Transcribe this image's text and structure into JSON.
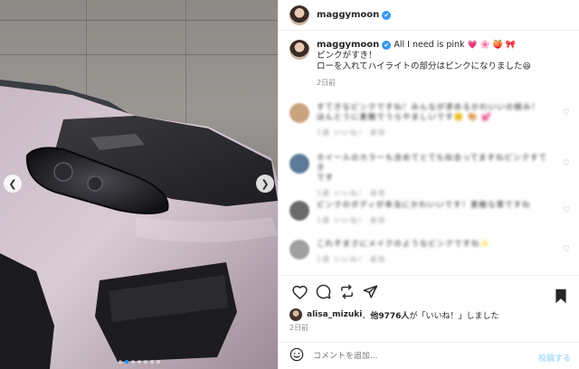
{
  "post": {
    "username": "maggymoon",
    "verified_mark": "✔",
    "caption": {
      "first_line": "All I need is pink",
      "first_line_emojis": "💗 🌸 🍑 🎀",
      "line2": "ピンクがすき！",
      "line3": "ローを入れてハイライトの部分はピンクになりました",
      "line3_emoji": "😆",
      "time": "2日前"
    },
    "photo": {
      "slide_count": 7,
      "active_slide": 2,
      "prev_icon": "chevron-left-icon",
      "next_icon": "chevron-right-icon"
    }
  },
  "comments": [
    {
      "text1": "すてきなピンクですね！みんなが求めるかわいいの極み！",
      "text2": "ほんとうに素敵でうらやましいです🙂 🎨 💕",
      "meta": "1週 いいね！ 返信",
      "avatar_color": "#c9a27e"
    },
    {
      "text1": "ホイールのカラーも含めてとても似合ってますねピンクすてき",
      "text2": "です",
      "meta": "1週 いいね！ 返信",
      "avatar_color": "#5d7a99"
    },
    {
      "text1": "ピンクのボディが本当にかわいいです！素敵な車ですね",
      "text2": "",
      "meta": "1週 いいね！ 返信",
      "avatar_color": "#6b6b6b"
    },
    {
      "text1": "これぞまさにメイクのようなピンクですね✨",
      "text2": "",
      "meta": "1週 いいね！ 返信",
      "avatar_color": "#a0a0a0"
    }
  ],
  "actions": {
    "like_icon": "heart-icon",
    "comment_icon": "comment-icon",
    "share_icon": "repost-icon",
    "send_icon": "send-icon",
    "save_icon": "bookmark-icon"
  },
  "likes": {
    "user": "alisa_mizuki",
    "connector": "、",
    "others": "他9776人",
    "suffix": "が「いいね！」しました"
  },
  "post_time": "2日前",
  "comment_box": {
    "placeholder": "コメントを追加...",
    "post_label": "投稿する",
    "emoji_icon": "smiley-icon"
  }
}
